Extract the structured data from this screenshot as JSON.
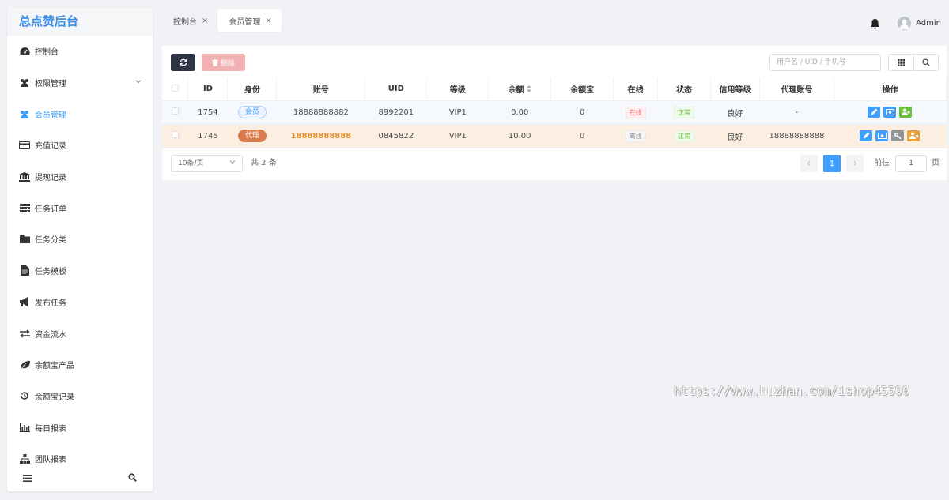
{
  "app": {
    "title": "总点赞后台"
  },
  "sidebar": {
    "items": [
      {
        "label": "控制台",
        "icon": "dashboard-icon"
      },
      {
        "label": "权限管理",
        "icon": "users-icon"
      },
      {
        "label": "会员管理",
        "icon": "members-icon"
      },
      {
        "label": "充值记录",
        "icon": "credit-card-icon"
      },
      {
        "label": "提现记录",
        "icon": "bank-icon"
      },
      {
        "label": "任务订单",
        "icon": "server-icon"
      },
      {
        "label": "任务分类",
        "icon": "folder-icon"
      },
      {
        "label": "任务模板",
        "icon": "file-icon"
      },
      {
        "label": "发布任务",
        "icon": "bullhorn-icon"
      },
      {
        "label": "资金流水",
        "icon": "exchange-icon"
      },
      {
        "label": "余额宝产品",
        "icon": "leaf-icon"
      },
      {
        "label": "余额宝记录",
        "icon": "history-icon"
      },
      {
        "label": "每日报表",
        "icon": "bar-chart-icon"
      },
      {
        "label": "团队报表",
        "icon": "sitemap-icon"
      }
    ],
    "active_index": 2
  },
  "tabs": [
    {
      "label": "控制台",
      "close": "×"
    },
    {
      "label": "会员管理",
      "close": "×"
    }
  ],
  "header": {
    "user": "Admin"
  },
  "toolbar": {
    "delete_label": "删除",
    "search_placeholder": "用户名 / UID / 手机号"
  },
  "table": {
    "columns": [
      "ID",
      "身份",
      "账号",
      "UID",
      "等级",
      "余额",
      "余额宝",
      "在线",
      "状态",
      "信用等级",
      "代理账号",
      "操作"
    ],
    "rows": [
      {
        "id": "1754",
        "role": "会员",
        "account": "18888888882",
        "uid": "8992201",
        "level": "VIP1",
        "balance": "0.00",
        "yuebao": "0",
        "online": "在线",
        "status": "正常",
        "credit": "良好",
        "agent": "-"
      },
      {
        "id": "1745",
        "role": "代理",
        "account": "18888888888",
        "uid": "0845822",
        "level": "VIP1",
        "balance": "10.00",
        "yuebao": "0",
        "online": "离线",
        "status": "正常",
        "credit": "良好",
        "agent": "18888888888"
      }
    ]
  },
  "pagination": {
    "page_size": "10条/页",
    "total": "共 2 条",
    "current": "1",
    "goto_label": "前往",
    "goto_value": "1",
    "page_suffix": "页"
  },
  "watermark": "https://www.huzhan.com/ishop45590",
  "colors": {
    "accent": "#409eff",
    "agent_tag": "#d97b4c",
    "online_red": "#f56c6c",
    "ok_green": "#67c23a"
  }
}
